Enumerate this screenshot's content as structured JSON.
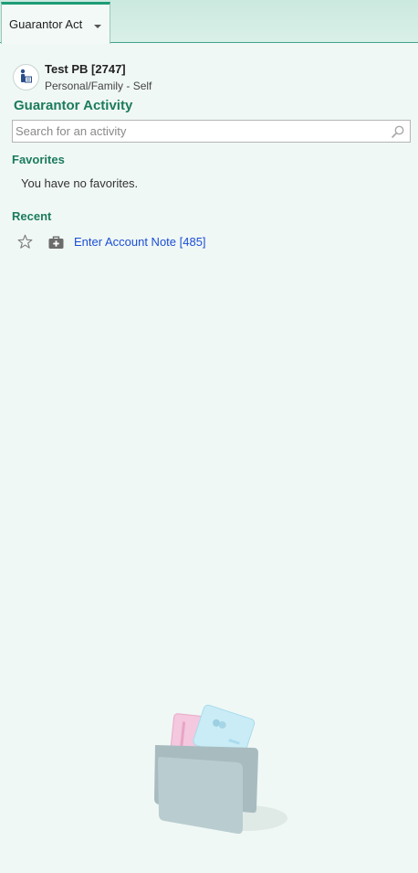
{
  "tab": {
    "label": "Guarantor Act"
  },
  "patient": {
    "name": "Test PB [2747]",
    "relationship": "Personal/Family - Self"
  },
  "activity": {
    "title": "Guarantor Activity",
    "search_placeholder": "Search for an activity"
  },
  "favorites": {
    "heading": "Favorites",
    "empty_text": "You have no favorites."
  },
  "recent": {
    "heading": "Recent",
    "items": [
      {
        "label": "Enter Account Note [485]"
      }
    ]
  },
  "colors": {
    "accent": "#1c7b5d",
    "link": "#1b4fd6",
    "tab_accent": "#1e9c78"
  },
  "icons": {
    "tab_menu": "chevron-down-icon",
    "patient": "guarantor-person-icon",
    "search": "search-icon",
    "favorite": "star-icon",
    "activity": "medical-bag-icon",
    "empty_state": "wallet-cards-illustration"
  }
}
